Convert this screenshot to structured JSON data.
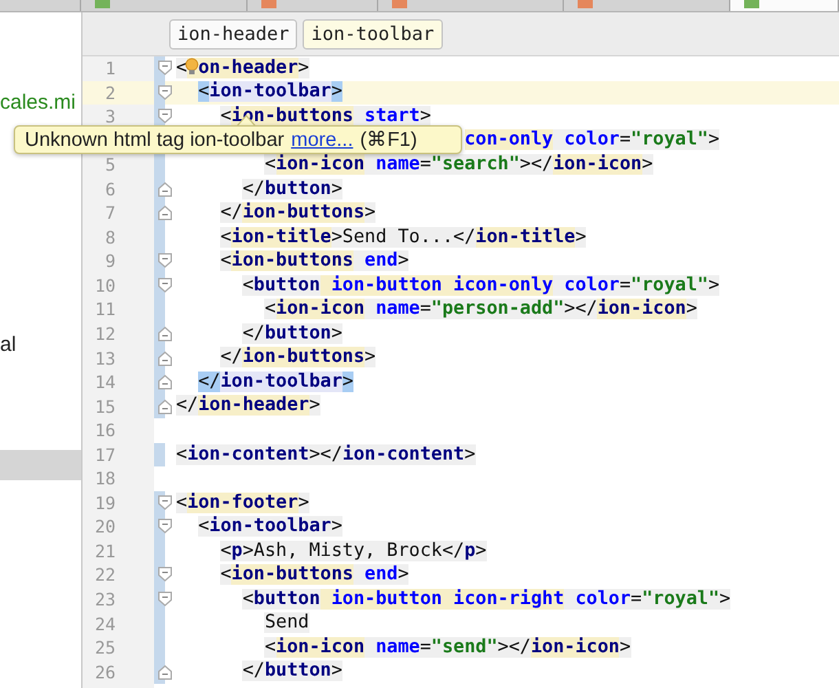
{
  "tabs": [
    {
      "selected": false
    },
    {
      "selected": false,
      "color": "#74b35a"
    },
    {
      "selected": false,
      "color": "#e5875c"
    },
    {
      "selected": false,
      "color": "#e5875c"
    },
    {
      "selected": false,
      "color": "#e5875c"
    },
    {
      "selected": true,
      "color": "#74b35a"
    }
  ],
  "sidebar": {
    "rows": [
      {
        "kind": "file",
        "text": "cales.mi",
        "selected": false
      },
      {
        "kind": "plain",
        "text": "al",
        "selected": false
      },
      {
        "kind": "blank",
        "selected": true
      }
    ]
  },
  "breadcrumbs": [
    {
      "label": "ion-header",
      "selected": false
    },
    {
      "label": "ion-toolbar",
      "selected": true
    }
  ],
  "tooltip": {
    "message": "Unknown html tag ion-toolbar",
    "link": "more...",
    "shortcut": "(⌘F1)"
  },
  "lines": [
    {
      "number": "1",
      "kind": "open",
      "marked": true,
      "current": false,
      "tokens": [
        {
          "kind": "punct",
          "text": "<"
        },
        {
          "kind": "covered_tag",
          "text": "on-header"
        },
        {
          "kind": "punct",
          "text": ">"
        }
      ],
      "children": [
        {
          "number": "2",
          "kind": "open",
          "marked": true,
          "current": true,
          "tokens": [
            {
              "kind": "match",
              "text": "<"
            },
            {
              "kind": "mtag",
              "text": "ion-toolbar"
            },
            {
              "kind": "match",
              "text": ">"
            }
          ],
          "children": [
            {
              "number": "3",
              "kind": "open",
              "marked": true,
              "current": false,
              "tokens": [
                {
                  "kind": "punct",
                  "text": "<"
                },
                {
                  "kind": "utag",
                  "text": "ion-buttons"
                },
                {
                  "kind": "attr",
                  "text": " start"
                },
                {
                  "kind": "punct",
                  "text": ">"
                }
              ],
              "children": [
                {
                  "kind": "covered",
                  "current": false,
                  "tokens": [
                    {
                      "kind": "uattr",
                      "text": "con-only"
                    },
                    {
                      "kind": "attr",
                      "text": " color"
                    },
                    {
                      "kind": "punct",
                      "text": "="
                    },
                    {
                      "kind": "value",
                      "text": "\"royal\""
                    },
                    {
                      "kind": "punct",
                      "text": ">"
                    }
                  ],
                  "children": [
                    {
                      "number": "5",
                      "kind": "plain",
                      "marked": true,
                      "current": false,
                      "tokens": [
                        {
                          "kind": "punct",
                          "text": "<"
                        },
                        {
                          "kind": "utag",
                          "text": "ion-icon"
                        },
                        {
                          "kind": "attr",
                          "text": " name"
                        },
                        {
                          "kind": "punct",
                          "text": "="
                        },
                        {
                          "kind": "value",
                          "text": "\"search\""
                        },
                        {
                          "kind": "punct",
                          "text": "></"
                        },
                        {
                          "kind": "utag",
                          "text": "ion-icon"
                        },
                        {
                          "kind": "punct",
                          "text": ">"
                        }
                      ]
                    }
                  ]
                },
                {
                  "number": "6",
                  "kind": "close",
                  "marked": true,
                  "current": false,
                  "tokens": [
                    {
                      "kind": "punct",
                      "text": "</"
                    },
                    {
                      "kind": "tag",
                      "text": "button"
                    },
                    {
                      "kind": "punct",
                      "text": ">"
                    }
                  ]
                }
              ]
            },
            {
              "number": "7",
              "kind": "close",
              "marked": true,
              "current": false,
              "tokens": [
                {
                  "kind": "punct",
                  "text": "</"
                },
                {
                  "kind": "utag",
                  "text": "ion-buttons"
                },
                {
                  "kind": "punct",
                  "text": ">"
                }
              ]
            },
            {
              "number": "8",
              "kind": "plain",
              "marked": true,
              "current": false,
              "tokens": [
                {
                  "kind": "punct",
                  "text": "<"
                },
                {
                  "kind": "utag",
                  "text": "ion-title"
                },
                {
                  "kind": "punct",
                  "text": ">"
                },
                {
                  "kind": "text",
                  "text": "Send To..."
                },
                {
                  "kind": "punct",
                  "text": "</"
                },
                {
                  "kind": "utag",
                  "text": "ion-title"
                },
                {
                  "kind": "punct",
                  "text": ">"
                }
              ]
            },
            {
              "number": "9",
              "kind": "open",
              "marked": true,
              "current": false,
              "tokens": [
                {
                  "kind": "punct",
                  "text": "<"
                },
                {
                  "kind": "utag",
                  "text": "ion-buttons"
                },
                {
                  "kind": "attr",
                  "text": " end"
                },
                {
                  "kind": "punct",
                  "text": ">"
                }
              ],
              "children": [
                {
                  "number": "10",
                  "kind": "open",
                  "marked": true,
                  "current": false,
                  "tokens": [
                    {
                      "kind": "punct",
                      "text": "<"
                    },
                    {
                      "kind": "tag",
                      "text": "button"
                    },
                    {
                      "kind": "uattr",
                      "text": " ion-button"
                    },
                    {
                      "kind": "uattr",
                      "text": " icon-only"
                    },
                    {
                      "kind": "attr",
                      "text": " color"
                    },
                    {
                      "kind": "punct",
                      "text": "="
                    },
                    {
                      "kind": "value",
                      "text": "\"royal\""
                    },
                    {
                      "kind": "punct",
                      "text": ">"
                    }
                  ],
                  "children": [
                    {
                      "number": "11",
                      "kind": "plain",
                      "marked": true,
                      "current": false,
                      "tokens": [
                        {
                          "kind": "punct",
                          "text": "<"
                        },
                        {
                          "kind": "utag",
                          "text": "ion-icon"
                        },
                        {
                          "kind": "attr",
                          "text": " name"
                        },
                        {
                          "kind": "punct",
                          "text": "="
                        },
                        {
                          "kind": "value",
                          "text": "\"person-add\""
                        },
                        {
                          "kind": "punct",
                          "text": "></"
                        },
                        {
                          "kind": "utag",
                          "text": "ion-icon"
                        },
                        {
                          "kind": "punct",
                          "text": ">"
                        }
                      ]
                    }
                  ]
                },
                {
                  "number": "12",
                  "kind": "close",
                  "marked": true,
                  "current": false,
                  "tokens": [
                    {
                      "kind": "punct",
                      "text": "</"
                    },
                    {
                      "kind": "tag",
                      "text": "button"
                    },
                    {
                      "kind": "punct",
                      "text": ">"
                    }
                  ]
                }
              ]
            },
            {
              "number": "13",
              "kind": "close",
              "marked": true,
              "current": false,
              "tokens": [
                {
                  "kind": "punct",
                  "text": "</"
                },
                {
                  "kind": "utag",
                  "text": "ion-buttons"
                },
                {
                  "kind": "punct",
                  "text": ">"
                }
              ]
            }
          ]
        },
        {
          "number": "14",
          "kind": "close",
          "marked": true,
          "current": false,
          "tokens": [
            {
              "kind": "match",
              "text": "</"
            },
            {
              "kind": "mtag",
              "text": "ion-toolbar"
            },
            {
              "kind": "match",
              "text": ">"
            }
          ]
        }
      ]
    },
    {
      "number": "15",
      "kind": "close",
      "marked": true,
      "current": false,
      "tokens": [
        {
          "kind": "punct",
          "text": "</"
        },
        {
          "kind": "utag",
          "text": "ion-header"
        },
        {
          "kind": "punct",
          "text": ">"
        }
      ]
    },
    {
      "number": "16",
      "kind": "blank",
      "marked": false,
      "current": false
    },
    {
      "number": "17",
      "kind": "plain",
      "marked": true,
      "current": false,
      "tokens": [
        {
          "kind": "punct",
          "text": "<"
        },
        {
          "kind": "tag",
          "text": "ion-content"
        },
        {
          "kind": "punct",
          "text": "></"
        },
        {
          "kind": "tag",
          "text": "ion-content"
        },
        {
          "kind": "punct",
          "text": ">"
        }
      ]
    },
    {
      "number": "18",
      "kind": "blank",
      "marked": false,
      "current": false
    },
    {
      "number": "19",
      "kind": "open",
      "marked": true,
      "current": false,
      "tokens": [
        {
          "kind": "punct",
          "text": "<"
        },
        {
          "kind": "utag",
          "text": "ion-footer"
        },
        {
          "kind": "punct",
          "text": ">"
        }
      ],
      "children": [
        {
          "number": "20",
          "kind": "open",
          "marked": true,
          "current": false,
          "tokens": [
            {
              "kind": "punct",
              "text": "<"
            },
            {
              "kind": "tag",
              "text": "ion-toolbar"
            },
            {
              "kind": "punct",
              "text": ">"
            }
          ],
          "children": [
            {
              "number": "21",
              "kind": "plain",
              "marked": true,
              "current": false,
              "tokens": [
                {
                  "kind": "punct",
                  "text": "<"
                },
                {
                  "kind": "tag",
                  "text": "p"
                },
                {
                  "kind": "punct",
                  "text": ">"
                },
                {
                  "kind": "text",
                  "text": "Ash, Misty, Brock"
                },
                {
                  "kind": "punct",
                  "text": "</"
                },
                {
                  "kind": "tag",
                  "text": "p"
                },
                {
                  "kind": "punct",
                  "text": ">"
                }
              ]
            },
            {
              "number": "22",
              "kind": "open",
              "marked": true,
              "current": false,
              "tokens": [
                {
                  "kind": "punct",
                  "text": "<"
                },
                {
                  "kind": "utag",
                  "text": "ion-buttons"
                },
                {
                  "kind": "attr",
                  "text": " end"
                },
                {
                  "kind": "punct",
                  "text": ">"
                }
              ],
              "children": [
                {
                  "number": "23",
                  "kind": "open",
                  "marked": true,
                  "current": false,
                  "tokens": [
                    {
                      "kind": "punct",
                      "text": "<"
                    },
                    {
                      "kind": "tag",
                      "text": "button"
                    },
                    {
                      "kind": "uattr",
                      "text": " ion-button"
                    },
                    {
                      "kind": "uattr",
                      "text": " icon-right"
                    },
                    {
                      "kind": "attr",
                      "text": " color"
                    },
                    {
                      "kind": "punct",
                      "text": "="
                    },
                    {
                      "kind": "value",
                      "text": "\"royal\""
                    },
                    {
                      "kind": "punct",
                      "text": ">"
                    }
                  ],
                  "children": [
                    {
                      "number": "24",
                      "kind": "plain",
                      "marked": true,
                      "current": false,
                      "tokens": [
                        {
                          "kind": "text",
                          "text": "Send"
                        }
                      ]
                    },
                    {
                      "number": "25",
                      "kind": "plain",
                      "marked": true,
                      "current": false,
                      "tokens": [
                        {
                          "kind": "punct",
                          "text": "<"
                        },
                        {
                          "kind": "utag",
                          "text": "ion-icon"
                        },
                        {
                          "kind": "attr",
                          "text": " name"
                        },
                        {
                          "kind": "punct",
                          "text": "="
                        },
                        {
                          "kind": "value",
                          "text": "\"send\""
                        },
                        {
                          "kind": "punct",
                          "text": "></"
                        },
                        {
                          "kind": "utag",
                          "text": "ion-icon"
                        },
                        {
                          "kind": "punct",
                          "text": ">"
                        }
                      ]
                    }
                  ]
                },
                {
                  "number": "26",
                  "kind": "close",
                  "marked": true,
                  "current": false,
                  "tokens": [
                    {
                      "kind": "punct",
                      "text": "</"
                    },
                    {
                      "kind": "tag",
                      "text": "button"
                    },
                    {
                      "kind": "punct",
                      "text": ">"
                    }
                  ]
                }
              ]
            }
          ]
        }
      ]
    }
  ]
}
